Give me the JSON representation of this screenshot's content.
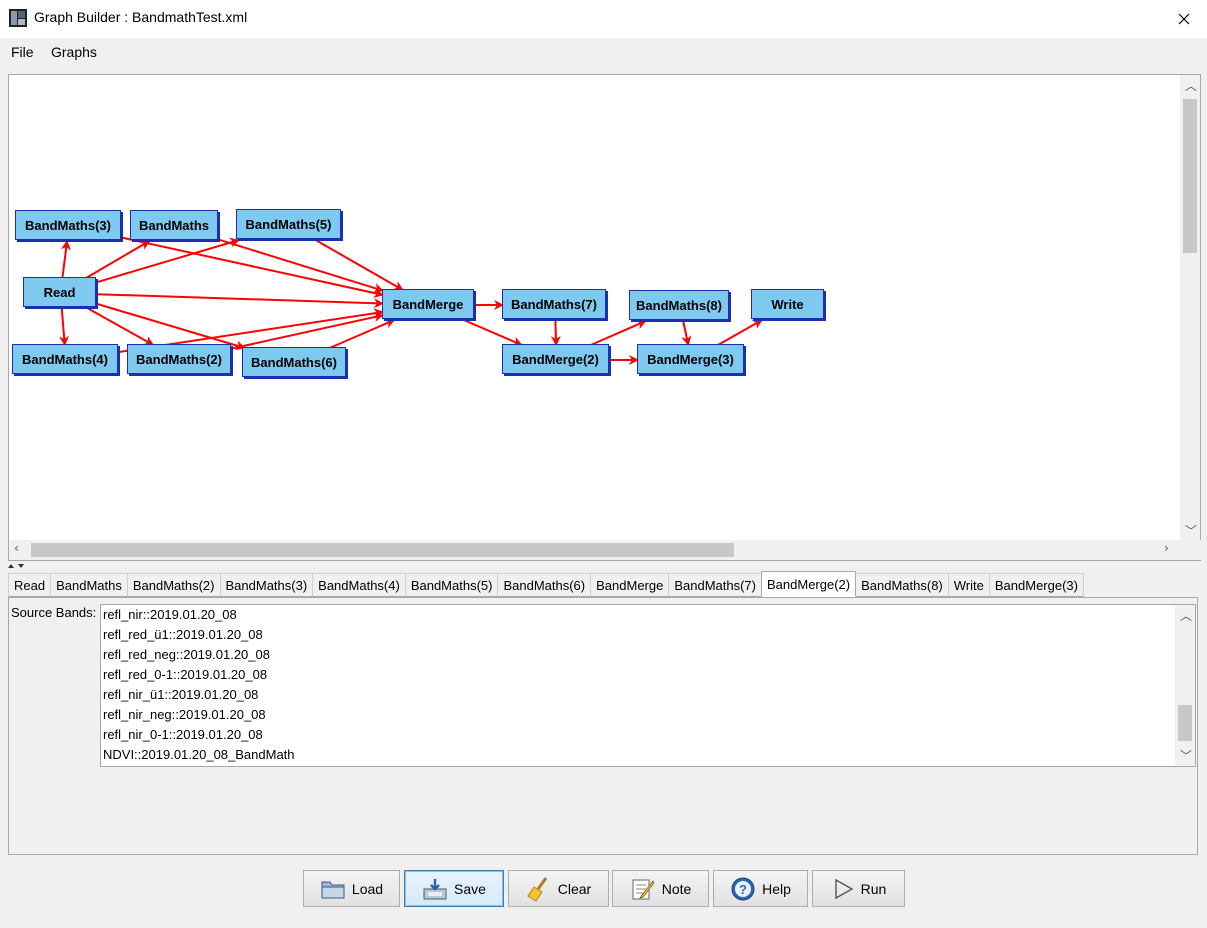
{
  "window": {
    "title": "Graph Builder : BandmathTest.xml"
  },
  "menu": {
    "items": [
      "File",
      "Graphs"
    ]
  },
  "graph": {
    "nodes": [
      {
        "id": "bm3",
        "label": "BandMaths(3)"
      },
      {
        "id": "bm",
        "label": "BandMaths"
      },
      {
        "id": "bm5",
        "label": "BandMaths(5)"
      },
      {
        "id": "read",
        "label": "Read"
      },
      {
        "id": "bandmerge",
        "label": "BandMerge"
      },
      {
        "id": "bm7",
        "label": "BandMaths(7)"
      },
      {
        "id": "bm8",
        "label": "BandMaths(8)"
      },
      {
        "id": "write",
        "label": "Write"
      },
      {
        "id": "bm4",
        "label": "BandMaths(4)"
      },
      {
        "id": "bm2",
        "label": "BandMaths(2)"
      },
      {
        "id": "bm6",
        "label": "BandMaths(6)"
      },
      {
        "id": "bmerge2",
        "label": "BandMerge(2)"
      },
      {
        "id": "bmerge3",
        "label": "BandMerge(3)"
      }
    ],
    "edges": [
      [
        "read",
        "bm3"
      ],
      [
        "read",
        "bm"
      ],
      [
        "read",
        "bm5"
      ],
      [
        "read",
        "bm4"
      ],
      [
        "read",
        "bm2"
      ],
      [
        "read",
        "bm6"
      ],
      [
        "read",
        "bandmerge"
      ],
      [
        "bm3",
        "bandmerge"
      ],
      [
        "bm",
        "bandmerge"
      ],
      [
        "bm5",
        "bandmerge"
      ],
      [
        "bm4",
        "bandmerge"
      ],
      [
        "bm2",
        "bandmerge"
      ],
      [
        "bm6",
        "bandmerge"
      ],
      [
        "bandmerge",
        "bm7"
      ],
      [
        "bandmerge",
        "bmerge2"
      ],
      [
        "bm7",
        "bmerge2"
      ],
      [
        "bmerge2",
        "bm8"
      ],
      [
        "bmerge2",
        "bmerge3"
      ],
      [
        "bm8",
        "bmerge3"
      ],
      [
        "bmerge3",
        "write"
      ]
    ],
    "edge_color": "#ff0000",
    "node_color": "#7ec9ef"
  },
  "tabs": {
    "items": [
      "Read",
      "BandMaths",
      "BandMaths(2)",
      "BandMaths(3)",
      "BandMaths(4)",
      "BandMaths(5)",
      "BandMaths(6)",
      "BandMerge",
      "BandMaths(7)",
      "BandMerge(2)",
      "BandMaths(8)",
      "Write",
      "BandMerge(3)"
    ],
    "active": "BandMerge(2)"
  },
  "panel": {
    "source_label": "Source Bands:",
    "bands": [
      "refl_nir::2019.01.20_08",
      "refl_red_ü1::2019.01.20_08",
      "refl_red_neg::2019.01.20_08",
      "refl_red_0-1::2019.01.20_08",
      "refl_nir_ü1::2019.01.20_08",
      "refl_nir_neg::2019.01.20_08",
      "refl_nir_0-1::2019.01.20_08",
      "NDVI::2019.01.20_08_BandMath"
    ]
  },
  "buttons": {
    "load": "Load",
    "save": "Save",
    "clear": "Clear",
    "note": "Note",
    "help": "Help",
    "run": "Run"
  }
}
